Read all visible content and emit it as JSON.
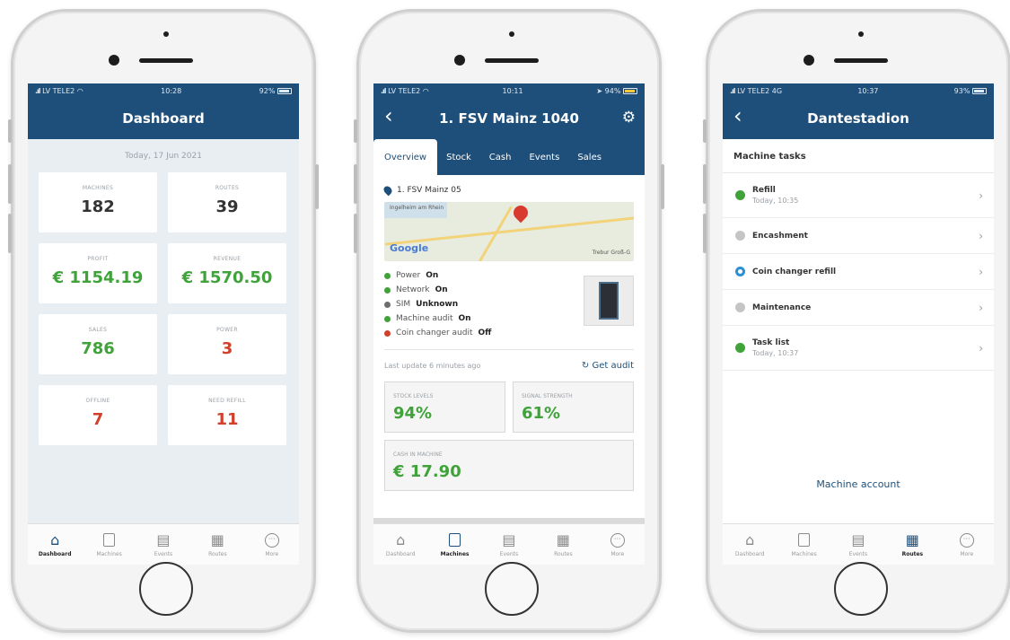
{
  "colors": {
    "brand": "#1e4f7a",
    "green": "#3fa33a",
    "red": "#d0402b",
    "dashboard_bg": "#e9eef2"
  },
  "screen1": {
    "status": {
      "carrier": "LV TELE2",
      "time": "10:28",
      "battery": "92%"
    },
    "title": "Dashboard",
    "date": "Today, 17 Jun 2021",
    "cards": [
      {
        "label": "MACHINES",
        "value": "182",
        "color": "dark"
      },
      {
        "label": "ROUTES",
        "value": "39",
        "color": "dark"
      },
      {
        "label": "PROFIT",
        "value": "€ 1154.19",
        "color": "green"
      },
      {
        "label": "REVENUE",
        "value": "€ 1570.50",
        "color": "green"
      },
      {
        "label": "SALES",
        "value": "786",
        "color": "green"
      },
      {
        "label": "POWER",
        "value": "3",
        "color": "red"
      },
      {
        "label": "OFFLINE",
        "value": "7",
        "color": "red"
      },
      {
        "label": "NEED REFILL",
        "value": "11",
        "color": "red"
      }
    ],
    "tabs": [
      "Dashboard",
      "Machines",
      "Events",
      "Routes",
      "More"
    ],
    "active_tab": "Dashboard"
  },
  "screen2": {
    "status": {
      "carrier": "LV TELE2",
      "time": "10:11",
      "battery": "94%"
    },
    "title": "1. FSV Mainz 1040",
    "subtabs": [
      "Overview",
      "Stock",
      "Cash",
      "Events",
      "Sales"
    ],
    "active_subtab": "Overview",
    "location": "1. FSV Mainz 05",
    "map": {
      "brand": "Google",
      "town": "Ingelheim am Rhein",
      "town2": "Trebur  Groß-G"
    },
    "statuses": [
      {
        "label": "Power",
        "value": "On",
        "color": "green"
      },
      {
        "label": "Network",
        "value": "On",
        "color": "green"
      },
      {
        "label": "SIM",
        "value": "Unknown",
        "color": "grey"
      },
      {
        "label": "Machine audit",
        "value": "On",
        "color": "green"
      },
      {
        "label": "Coin changer audit",
        "value": "Off",
        "color": "red"
      }
    ],
    "last_update": "Last update 6 minutes ago",
    "get_audit": "Get audit",
    "stock_levels": {
      "label": "STOCK LEVELS",
      "value": "94%"
    },
    "signal_strength": {
      "label": "SIGNAL STRENGTH",
      "value": "61%"
    },
    "cash_in_machine": {
      "label": "CASH IN MACHINE",
      "value": "€ 17.90"
    },
    "tabs": [
      "Dashboard",
      "Machines",
      "Events",
      "Routes",
      "More"
    ],
    "active_tab": "Machines"
  },
  "screen3": {
    "status": {
      "carrier": "LV TELE2  4G",
      "time": "10:37",
      "battery": "93%"
    },
    "title": "Dantestadion",
    "section": "Machine tasks",
    "tasks": [
      {
        "name": "Refill",
        "sub": "Today, 10:35",
        "state": "done"
      },
      {
        "name": "Encashment",
        "sub": "",
        "state": "grey"
      },
      {
        "name": "Coin changer refill",
        "sub": "",
        "state": "blue"
      },
      {
        "name": "Maintenance",
        "sub": "",
        "state": "grey"
      },
      {
        "name": "Task list",
        "sub": "Today, 10:37",
        "state": "done"
      }
    ],
    "machine_account": "Machine account",
    "tabs": [
      "Dashboard",
      "Machines",
      "Events",
      "Routes",
      "More"
    ],
    "active_tab": "Routes"
  }
}
